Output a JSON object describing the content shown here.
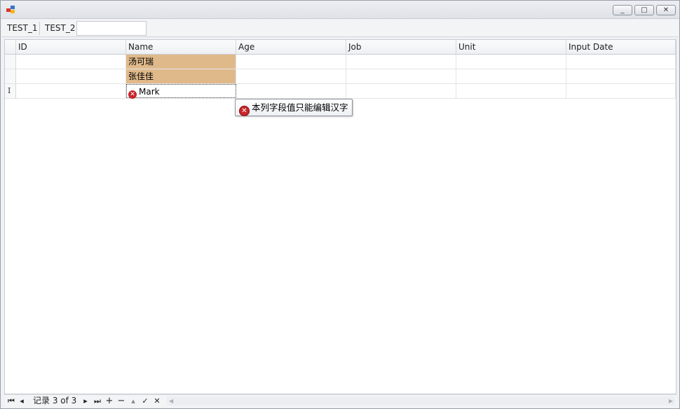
{
  "window": {
    "title": "",
    "minimize": "_",
    "maximize": "□",
    "close": "✕"
  },
  "toolbar": {
    "item1": "TEST_1",
    "item2": "TEST_2",
    "input_value": ""
  },
  "grid": {
    "columns": [
      "ID",
      "Name",
      "Age",
      "Job",
      "Unit",
      "Input Date"
    ],
    "rows": [
      {
        "indicator": "",
        "cells": [
          "",
          "汤可瑞",
          "",
          "",
          "",
          ""
        ]
      },
      {
        "indicator": "",
        "cells": [
          "",
          "张佳佳",
          "",
          "",
          "",
          ""
        ]
      },
      {
        "indicator": "I",
        "cells": [
          "",
          "Mark",
          "",
          "",
          "",
          ""
        ]
      }
    ],
    "highlight_color": "#e0b98a"
  },
  "tooltip": {
    "text": "本列字段值只能编辑汉字"
  },
  "navigator": {
    "record_text": "记录 3 of 3",
    "first": "⏮",
    "prev": "◂",
    "next": "▸",
    "last": "⏭",
    "add": "+",
    "remove": "−",
    "up": "▴",
    "save": "✓",
    "cancel": "✕"
  }
}
